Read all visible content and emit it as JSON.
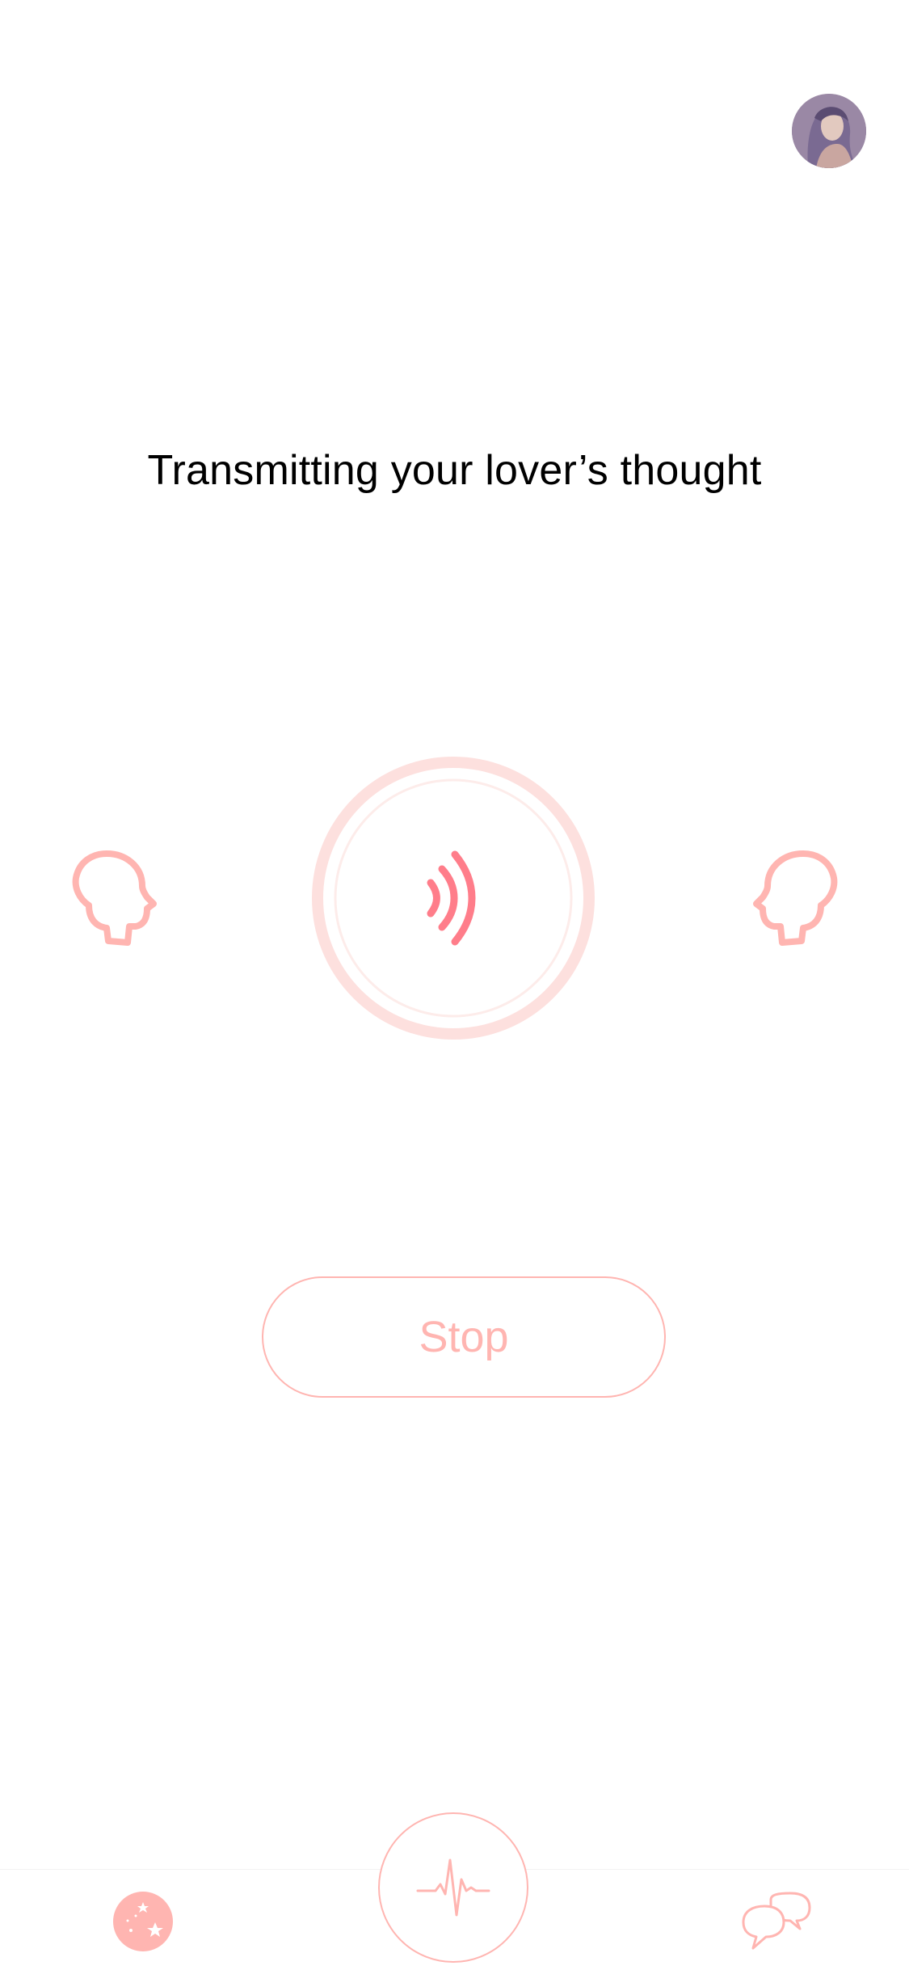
{
  "header": {
    "avatar_icon": "user-avatar-photo"
  },
  "main": {
    "status_title": "Transmitting your lover’s thought",
    "left_head_icon": "head-profile-icon",
    "right_head_icon": "head-profile-icon",
    "center_icon": "signal-waves-icon",
    "stop_label": "Stop"
  },
  "tab_bar": {
    "items": [
      {
        "icon": "stars-icon"
      },
      {
        "icon": "heartbeat-pulse-icon"
      },
      {
        "icon": "chat-bubbles-icon"
      }
    ]
  },
  "colors": {
    "accent": "#ffb5b1",
    "accent_strong": "#ff7d8a",
    "ring_light": "#fde0de",
    "text": "#000000",
    "background": "#ffffff"
  }
}
